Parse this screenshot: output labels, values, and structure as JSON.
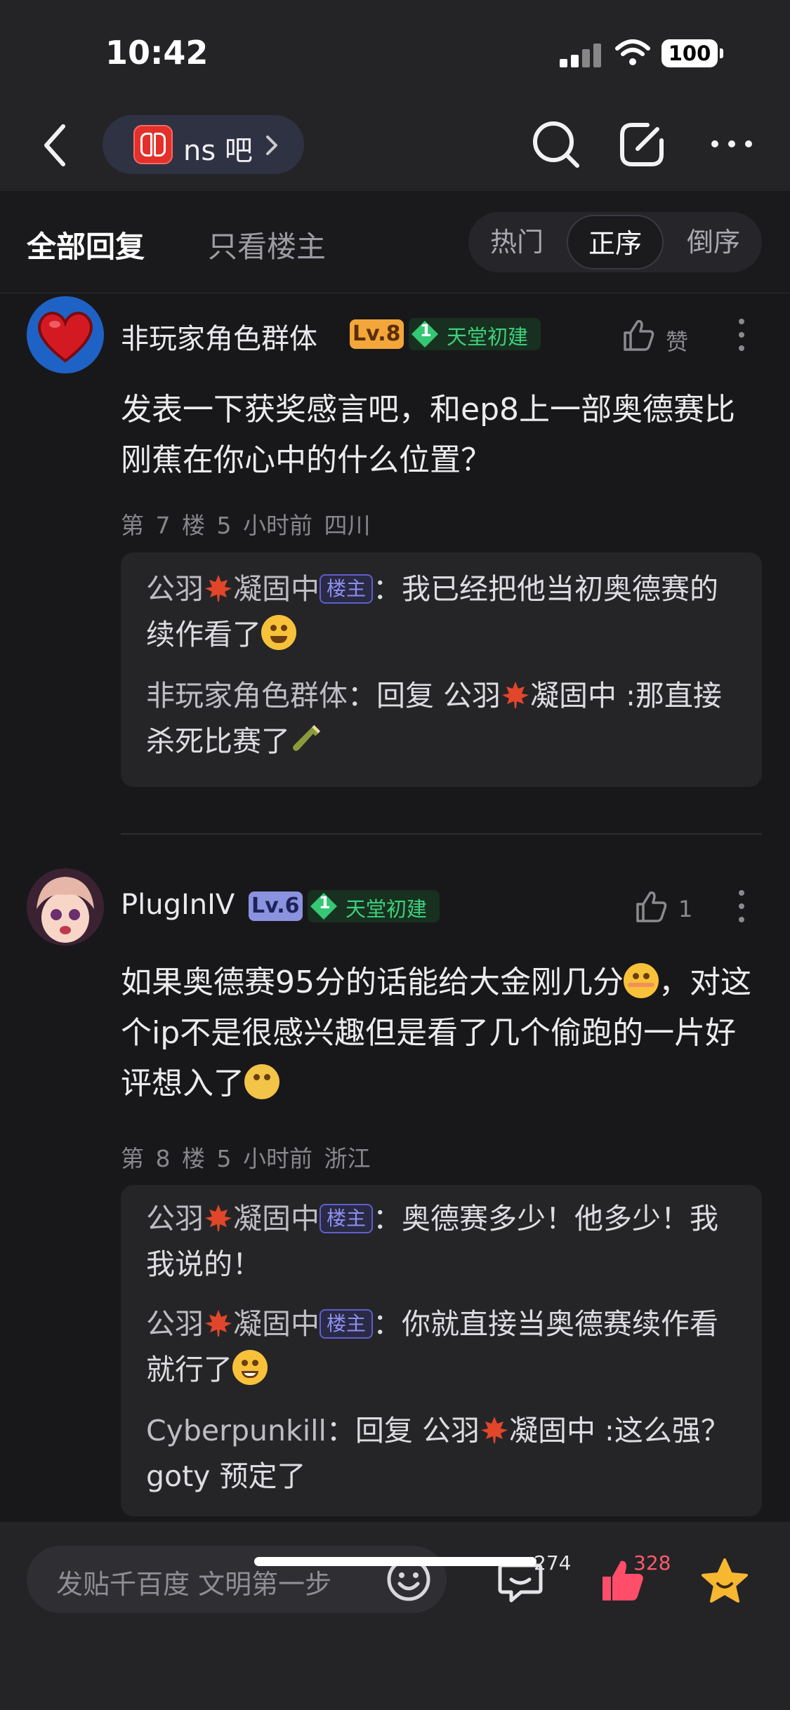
{
  "status_bar": {
    "time": "10:42",
    "battery": "100"
  },
  "nav": {
    "forum_name": "ns 吧"
  },
  "tabs": {
    "all": "全部回复",
    "owner_only": "只看楼主",
    "sort": [
      "热门",
      "正序",
      "倒序"
    ],
    "active_sort": "正序"
  },
  "posts": [
    {
      "username": "非玩家角色群体",
      "level": "Lv.8",
      "level_color": "#f3a73a",
      "badge_num": "1",
      "badge_title": "天堂初建",
      "like_label": "赞",
      "content": "发表一下获奖感言吧，和ep8上一部奥德赛比刚蕉在你心中的什么位置？",
      "meta": "第 7 楼   5 小时前   四川",
      "replies": [
        {
          "author": "公羽",
          "author_suffix": "凝固中",
          "is_owner": true,
          "owner_tag": "楼主",
          "separator": "：",
          "text": "我已经把他当初奥德赛的续作看了",
          "emoji": "laugh"
        },
        {
          "author": "非玩家角色群体",
          "is_owner": false,
          "separator": "：",
          "text_prefix": "回复 公羽",
          "text_suffix": "凝固中 :那直接杀死比赛了",
          "emoji": "bottle"
        }
      ]
    },
    {
      "username": "PlugInIV",
      "level": "Lv.6",
      "level_color": "#8b93e0",
      "badge_num": "1",
      "badge_title": "天堂初建",
      "like_count": "1",
      "content_part1": "如果奥德赛95分的话能给大金刚几分",
      "content_part2": "，对这个ip不是很感兴趣但是看了几个偷跑的一片好评想入了",
      "meta": "第 8 楼   5 小时前   浙江",
      "replies": [
        {
          "author": "公羽",
          "author_suffix": "凝固中",
          "is_owner": true,
          "owner_tag": "楼主",
          "separator": "：",
          "text": "奥德赛多少！他多少！我我说的！"
        },
        {
          "author": "公羽",
          "author_suffix": "凝固中",
          "is_owner": true,
          "owner_tag": "楼主",
          "separator": "：",
          "text": "你就直接当奥德赛续作看就行了",
          "emoji": "grin"
        },
        {
          "author": "Cyberpunkill",
          "is_owner": false,
          "separator": "：",
          "text_prefix": "回复 公羽",
          "text_suffix": "凝固中 :这么强？goty 预定了"
        }
      ]
    }
  ],
  "bottom_bar": {
    "input_placeholder": "发贴千百度 文明第一步",
    "comment_count": "274",
    "like_count": "328",
    "accent_like": "#ff4d6a",
    "accent_fav": "#f7b731"
  }
}
